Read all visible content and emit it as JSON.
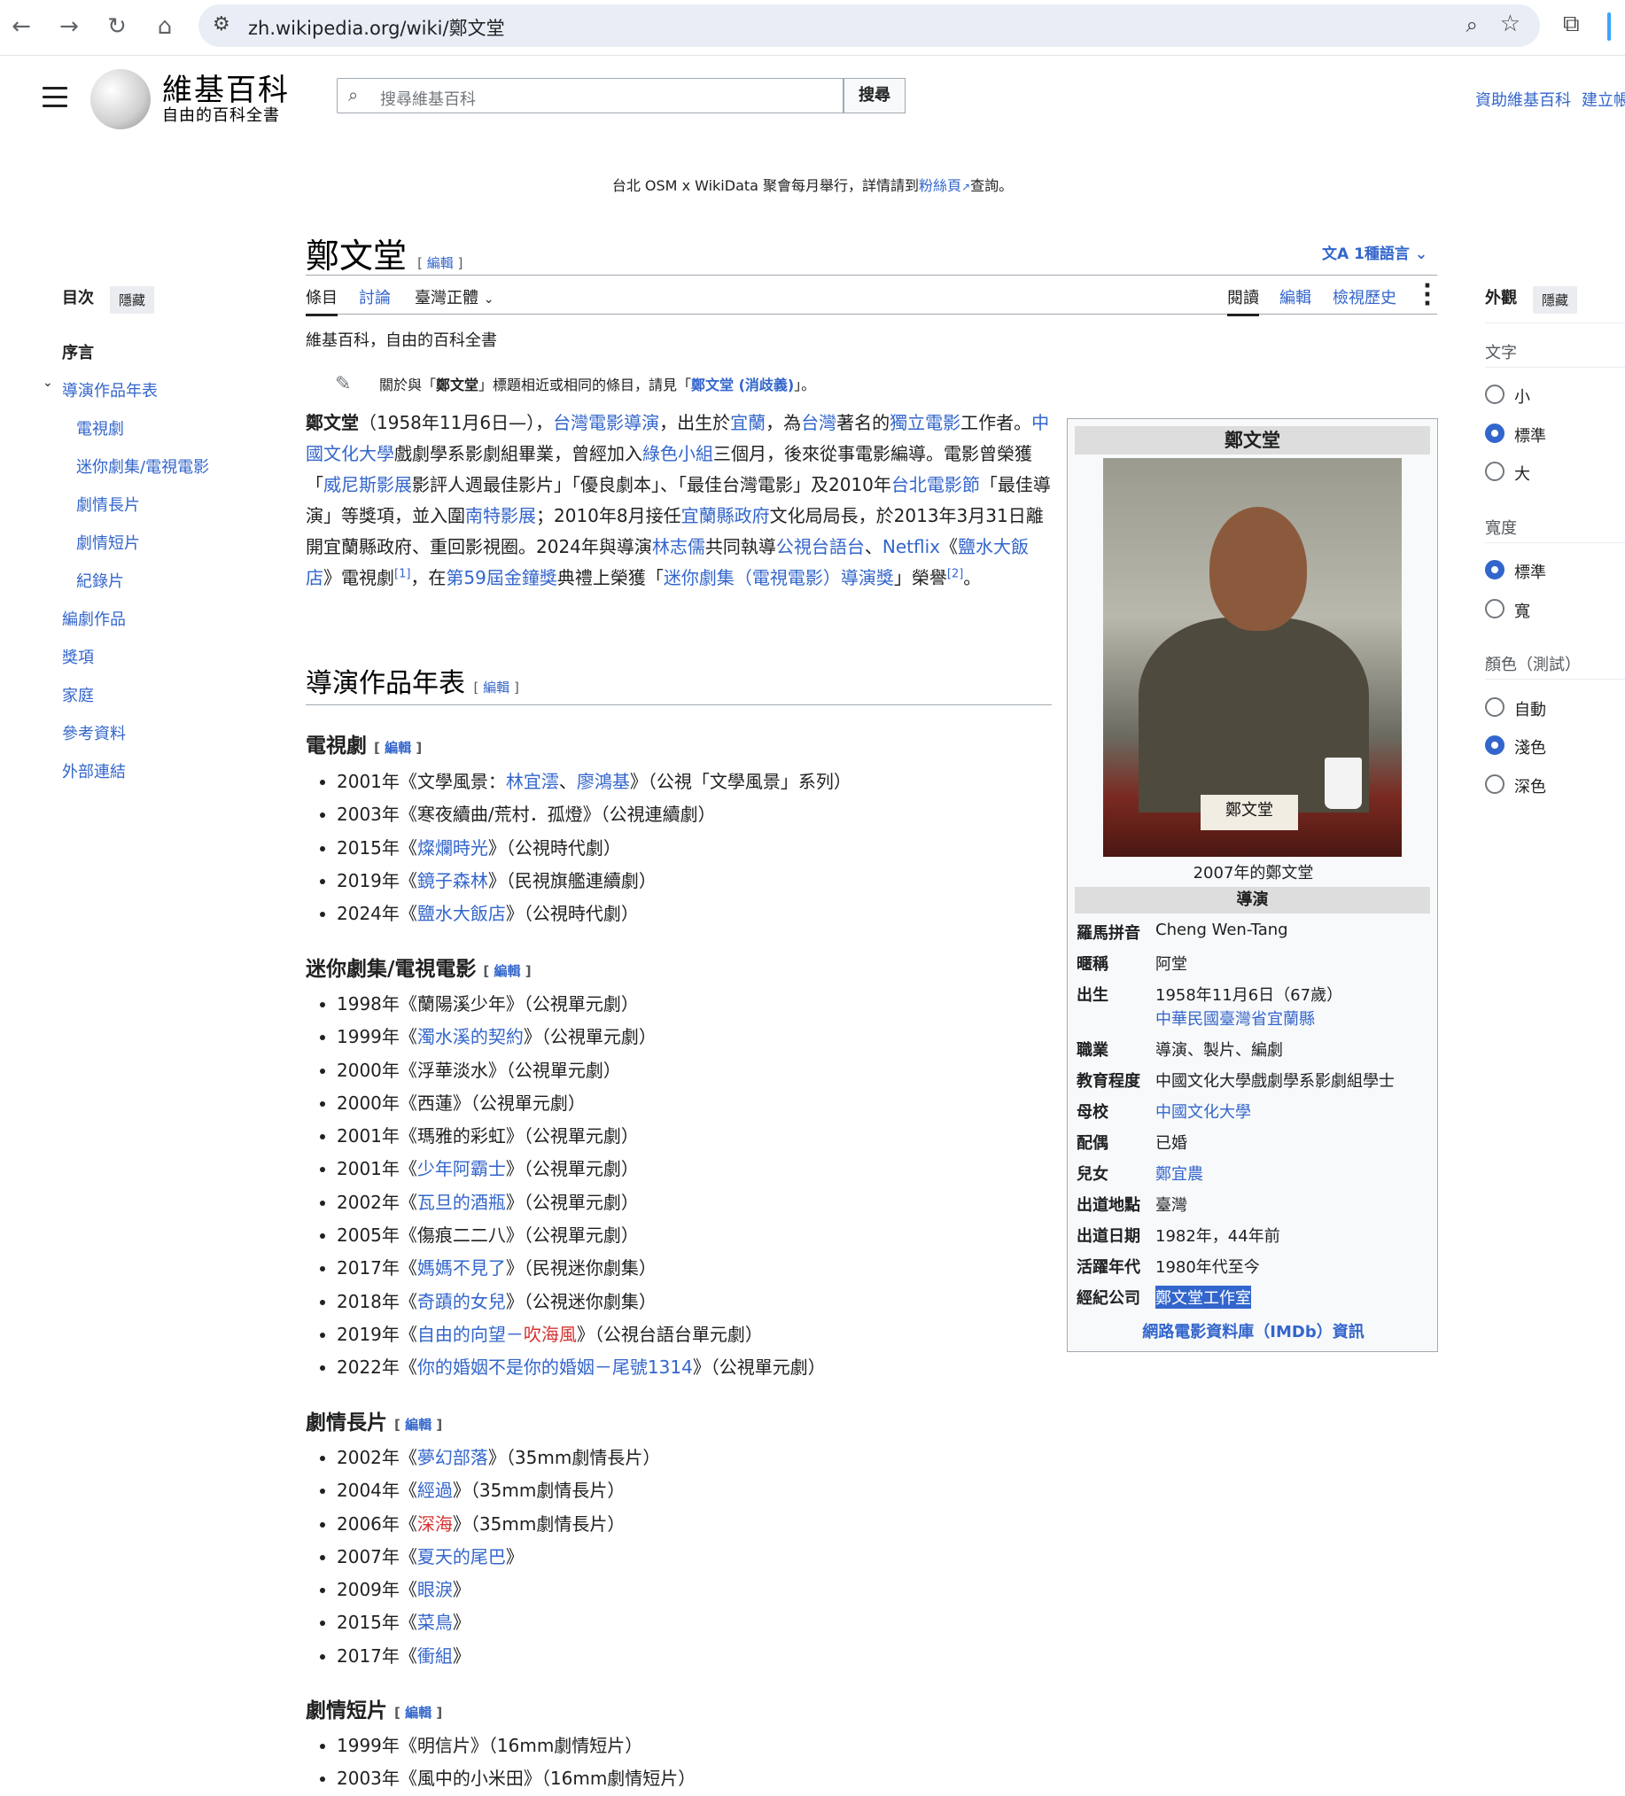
{
  "browser": {
    "url": "zh.wikipedia.org/wiki/鄭文堂",
    "back": "←",
    "forward": "→",
    "reload": "↻",
    "home": "⌂"
  },
  "header": {
    "logo_title": "維基百科",
    "logo_subtitle": "自由的百科全書",
    "search_placeholder": "搜尋維基百科",
    "search_button": "搜尋",
    "links": [
      "資助維基百科",
      "建立帳號"
    ]
  },
  "sitenotice": {
    "before": "台北 OSM x WikiData 聚會每月舉行，詳情請到",
    "link": "粉絲頁",
    "after": "查詢。"
  },
  "toc": {
    "title": "目次",
    "hide": "隱藏",
    "items": [
      "序言",
      "導演作品年表",
      "電視劇",
      "迷你劇集/電視電影",
      "劇情長片",
      "劇情短片",
      "紀錄片",
      "編劇作品",
      "獎項",
      "家庭",
      "參考資料",
      "外部連結"
    ]
  },
  "appearance": {
    "title": "外觀",
    "hide": "隱藏",
    "text_label": "文字",
    "text_options": [
      "小",
      "標準",
      "大"
    ],
    "width_label": "寬度",
    "width_options": [
      "標準",
      "寬"
    ],
    "color_label": "顏色（測試）",
    "color_options": [
      "自動",
      "淺色",
      "深色"
    ]
  },
  "page": {
    "title": "鄭文堂",
    "edit": "編輯",
    "languages": "1種語言",
    "tabs": {
      "article": "條目",
      "talk": "討論",
      "variant": "臺灣正體",
      "read": "閱讀",
      "edit": "編輯",
      "history": "檢視歷史"
    },
    "tagline": "維基百科，自由的百科全書",
    "hatnote": {
      "pre": "關於與「",
      "bold": "鄭文堂",
      "mid": "」標題相近或相同的條目，請見「",
      "link": "鄭文堂 (消歧義)",
      "post": "」。"
    }
  },
  "lead": [
    {
      "t": "鄭文堂",
      "b": true
    },
    {
      "t": "（1958年11月6日—），"
    },
    {
      "t": "台灣電影導演",
      "l": true
    },
    {
      "t": "，出生於"
    },
    {
      "t": "宜蘭",
      "l": true
    },
    {
      "t": "，為"
    },
    {
      "t": "台灣",
      "l": true
    },
    {
      "t": "著名的"
    },
    {
      "t": "獨立電影",
      "l": true
    },
    {
      "t": "工作者。"
    },
    {
      "t": "中國文化大學",
      "l": true
    },
    {
      "t": "戲劇學系影劇組畢業，曾經加入"
    },
    {
      "t": "綠色小組",
      "l": true
    },
    {
      "t": "三個月，後來從事電影編導。電影曾榮獲「"
    },
    {
      "t": "威尼斯影展",
      "l": true
    },
    {
      "t": "影評人週最佳影片」「優良劇本」、「最佳台灣電影」及2010年"
    },
    {
      "t": "台北電影節",
      "l": true
    },
    {
      "t": "「最佳導演」等獎項，並入圍"
    },
    {
      "t": "南特影展",
      "l": true
    },
    {
      "t": "；2010年8月接任"
    },
    {
      "t": "宜蘭縣政府",
      "l": true
    },
    {
      "t": "文化局局長，於2013年3月31日離開宜蘭縣政府、重回影視圈。2024年與導演"
    },
    {
      "t": "林志儒",
      "l": true
    },
    {
      "t": "共同執導"
    },
    {
      "t": "公視台語台",
      "l": true
    },
    {
      "t": "、"
    },
    {
      "t": "Netflix",
      "l": true
    },
    {
      "t": "《"
    },
    {
      "t": "鹽水大飯店",
      "l": true
    },
    {
      "t": "》電視劇"
    },
    {
      "t": "[1]",
      "l": true,
      "sup": true
    },
    {
      "t": "，在"
    },
    {
      "t": "第59屆金鐘獎",
      "l": true
    },
    {
      "t": "典禮上榮獲「"
    },
    {
      "t": "迷你劇集（電視電影）導演獎",
      "l": true
    },
    {
      "t": "」榮譽"
    },
    {
      "t": "[2]",
      "l": true,
      "sup": true
    },
    {
      "t": "。"
    }
  ],
  "sections": {
    "directing": "導演作品年表",
    "edit": "編輯",
    "tv": {
      "title": "電視劇",
      "items": [
        [
          {
            "t": "2001年《文學風景："
          },
          {
            "t": "林宜澐",
            "l": true
          },
          {
            "t": "、"
          },
          {
            "t": "廖鴻基",
            "l": true
          },
          {
            "t": "》（公視「文學風景」系列）"
          }
        ],
        [
          {
            "t": "2003年《寒夜續曲/荒村．孤燈》（公視連續劇）"
          }
        ],
        [
          {
            "t": "2015年《"
          },
          {
            "t": "燦爛時光",
            "l": true
          },
          {
            "t": "》（公視時代劇）"
          }
        ],
        [
          {
            "t": "2019年《"
          },
          {
            "t": "鏡子森林",
            "l": true
          },
          {
            "t": "》（民視旗艦連續劇）"
          }
        ],
        [
          {
            "t": "2024年《"
          },
          {
            "t": "鹽水大飯店",
            "l": true
          },
          {
            "t": "》（公視時代劇）"
          }
        ]
      ]
    },
    "mini": {
      "title": "迷你劇集/電視電影",
      "items": [
        [
          {
            "t": "1998年《蘭陽溪少年》（公視單元劇）"
          }
        ],
        [
          {
            "t": "1999年《"
          },
          {
            "t": "濁水溪的契約",
            "l": true
          },
          {
            "t": "》（公視單元劇）"
          }
        ],
        [
          {
            "t": "2000年《浮華淡水》（公視單元劇）"
          }
        ],
        [
          {
            "t": "2000年《西蓮》（公視單元劇）"
          }
        ],
        [
          {
            "t": "2001年《瑪雅的彩虹》（公視單元劇）"
          }
        ],
        [
          {
            "t": "2001年《"
          },
          {
            "t": "少年阿霸士",
            "l": true
          },
          {
            "t": "》（公視單元劇）"
          }
        ],
        [
          {
            "t": "2002年《"
          },
          {
            "t": "瓦旦的酒瓶",
            "l": true
          },
          {
            "t": "》（公視單元劇）"
          }
        ],
        [
          {
            "t": "2005年《傷痕二二八》（公視單元劇）"
          }
        ],
        [
          {
            "t": "2017年《"
          },
          {
            "t": "媽媽不見了",
            "l": true
          },
          {
            "t": "》（民視迷你劇集）"
          }
        ],
        [
          {
            "t": "2018年《"
          },
          {
            "t": "奇蹟的女兒",
            "l": true
          },
          {
            "t": "》（公視迷你劇集）"
          }
        ],
        [
          {
            "t": "2019年《"
          },
          {
            "t": "自由的向望－",
            "l": true
          },
          {
            "t": "吹海風",
            "r": true
          },
          {
            "t": "》（公視台語台單元劇）"
          }
        ],
        [
          {
            "t": "2022年《"
          },
          {
            "t": "你的婚姻不是你的婚姻－尾號1314",
            "l": true
          },
          {
            "t": "》（公視單元劇）"
          }
        ]
      ]
    },
    "feature": {
      "title": "劇情長片",
      "items": [
        [
          {
            "t": "2002年《"
          },
          {
            "t": "夢幻部落",
            "l": true
          },
          {
            "t": "》（35mm劇情長片）"
          }
        ],
        [
          {
            "t": "2004年《"
          },
          {
            "t": "經過",
            "l": true
          },
          {
            "t": "》（35mm劇情長片）"
          }
        ],
        [
          {
            "t": "2006年《"
          },
          {
            "t": "深海",
            "r": true
          },
          {
            "t": "》（35mm劇情長片）"
          }
        ],
        [
          {
            "t": "2007年《"
          },
          {
            "t": "夏天的尾巴",
            "l": true
          },
          {
            "t": "》"
          }
        ],
        [
          {
            "t": "2009年《"
          },
          {
            "t": "眼淚",
            "l": true
          },
          {
            "t": "》"
          }
        ],
        [
          {
            "t": "2015年《"
          },
          {
            "t": "菜鳥",
            "l": true
          },
          {
            "t": "》"
          }
        ],
        [
          {
            "t": "2017年《"
          },
          {
            "t": "衝組",
            "l": true
          },
          {
            "t": "》"
          }
        ]
      ]
    },
    "short": {
      "title": "劇情短片",
      "items": [
        [
          {
            "t": "1999年《明信片》（16mm劇情短片）"
          }
        ],
        [
          {
            "t": "2003年《風中的小米田》（16mm劇情短片）"
          }
        ]
      ]
    }
  },
  "infobox": {
    "title": "鄭文堂",
    "plate": "鄭文堂",
    "caption": "2007年的鄭文堂",
    "section": "導演",
    "rows": [
      {
        "k": "羅馬拼音",
        "v": "Cheng Wen-Tang"
      },
      {
        "k": "暱稱",
        "v": "阿堂"
      },
      {
        "k": "出生",
        "v": "1958年11月6日（67歲）",
        "v2": "中華民國臺灣省宜蘭縣"
      },
      {
        "k": "職業",
        "v": "導演、製片、編劇"
      },
      {
        "k": "教育程度",
        "v": "中國文化大學戲劇學系影劇組學士"
      },
      {
        "k": "母校",
        "v": "中國文化大學",
        "link": true
      },
      {
        "k": "配偶",
        "v": "已婚"
      },
      {
        "k": "兒女",
        "v": "鄭宜農",
        "link": true
      },
      {
        "k": "出道地點",
        "v": "臺灣"
      },
      {
        "k": "出道日期",
        "v": "1982年，44年前"
      },
      {
        "k": "活躍年代",
        "v": "1980年代至今"
      },
      {
        "k": "經紀公司",
        "v": "鄭文堂工作室",
        "link": true,
        "hl": true
      }
    ],
    "footer": "網路電影資料庫（IMDb）資訊"
  }
}
